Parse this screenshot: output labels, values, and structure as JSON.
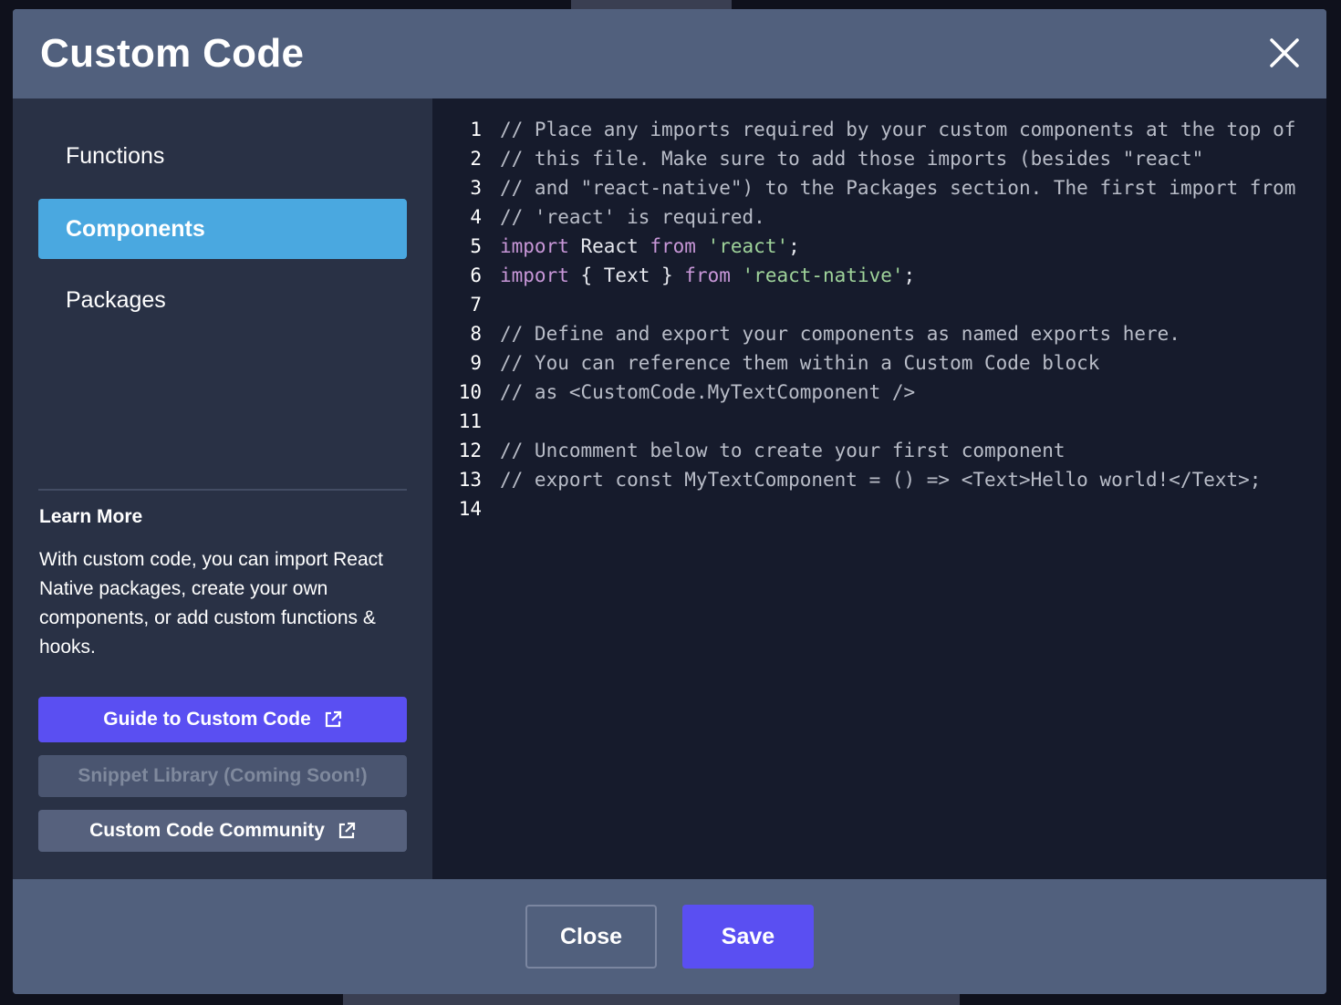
{
  "modal": {
    "title": "Custom Code",
    "close_icon": "close-icon"
  },
  "sidebar": {
    "items": [
      {
        "label": "Functions",
        "active": false
      },
      {
        "label": "Components",
        "active": true
      },
      {
        "label": "Packages",
        "active": false
      }
    ],
    "learn_more": {
      "title": "Learn More",
      "text": "With custom code, you can import React Native packages, create your own components, or add custom functions & hooks."
    },
    "buttons": {
      "guide": "Guide to Custom Code",
      "snippet": "Snippet Library (Coming Soon!)",
      "community": "Custom Code Community"
    }
  },
  "editor": {
    "lines": [
      {
        "n": "1",
        "tokens": [
          {
            "t": "// Place any imports required by your custom components at the top of",
            "c": "comment"
          }
        ]
      },
      {
        "n": "2",
        "tokens": [
          {
            "t": "// this file. Make sure to add those imports (besides \"react\"",
            "c": "comment"
          }
        ]
      },
      {
        "n": "3",
        "tokens": [
          {
            "t": "// and \"react-native\") to the Packages section. The first import from",
            "c": "comment"
          }
        ]
      },
      {
        "n": "4",
        "tokens": [
          {
            "t": "// 'react' is required.",
            "c": "comment"
          }
        ]
      },
      {
        "n": "5",
        "tokens": [
          {
            "t": "import",
            "c": "keyword"
          },
          {
            "t": " React ",
            "c": "plain"
          },
          {
            "t": "from",
            "c": "keyword"
          },
          {
            "t": " ",
            "c": "plain"
          },
          {
            "t": "'react'",
            "c": "string"
          },
          {
            "t": ";",
            "c": "plain"
          }
        ]
      },
      {
        "n": "6",
        "tokens": [
          {
            "t": "import",
            "c": "keyword"
          },
          {
            "t": " { Text } ",
            "c": "plain"
          },
          {
            "t": "from",
            "c": "keyword"
          },
          {
            "t": " ",
            "c": "plain"
          },
          {
            "t": "'react-native'",
            "c": "string"
          },
          {
            "t": ";",
            "c": "plain"
          }
        ]
      },
      {
        "n": "7",
        "tokens": []
      },
      {
        "n": "8",
        "tokens": [
          {
            "t": "// Define and export your components as named exports here.",
            "c": "comment"
          }
        ]
      },
      {
        "n": "9",
        "tokens": [
          {
            "t": "// You can reference them within a Custom Code block",
            "c": "comment"
          }
        ]
      },
      {
        "n": "10",
        "tokens": [
          {
            "t": "// as <CustomCode.MyTextComponent />",
            "c": "comment"
          }
        ]
      },
      {
        "n": "11",
        "tokens": []
      },
      {
        "n": "12",
        "tokens": [
          {
            "t": "// Uncomment below to create your first component",
            "c": "comment"
          }
        ]
      },
      {
        "n": "13",
        "tokens": [
          {
            "t": "// export const MyTextComponent = () => <Text>Hello world!</Text>;",
            "c": "comment"
          }
        ]
      },
      {
        "n": "14",
        "tokens": []
      }
    ]
  },
  "footer": {
    "close_label": "Close",
    "save_label": "Save"
  },
  "colors": {
    "accent": "#5a4ff2",
    "active_nav": "#4aa8e0",
    "header_bg": "#51607d",
    "sidebar_bg": "#293145",
    "editor_bg": "#161b2c"
  }
}
